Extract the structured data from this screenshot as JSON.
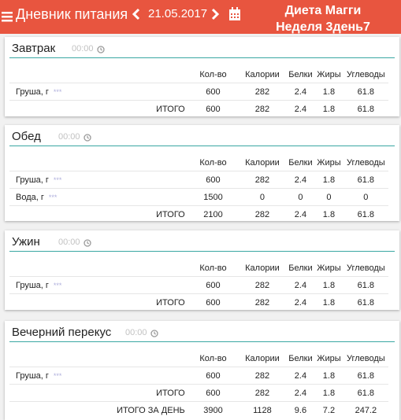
{
  "header": {
    "title": "Дневник питания",
    "date": "21.05.2017",
    "diet_line1": "Диета Магги",
    "diet_line2": "Неделя 3день7",
    "accent_color": "#e8553f",
    "icons": [
      "menu-icon",
      "chevron-left-icon",
      "chevron-right-icon",
      "calendar-icon",
      "clock-icon"
    ]
  },
  "columns": [
    "Кол-во",
    "Калории",
    "Белки",
    "Жиры",
    "Углеводы"
  ],
  "more_glyph": "***",
  "total_label": "ИТОГО",
  "day_total_label": "ИТОГО ЗА ДЕНЬ",
  "meals": [
    {
      "name": "Завтрак",
      "time": "00:00",
      "items": [
        {
          "name": "Груша, г",
          "qty": "600",
          "kcal": "282",
          "protein": "2.4",
          "fat": "1.8",
          "carbs": "61.8"
        }
      ],
      "total": {
        "qty": "600",
        "kcal": "282",
        "protein": "2.4",
        "fat": "1.8",
        "carbs": "61.8"
      }
    },
    {
      "name": "Обед",
      "time": "00:00",
      "items": [
        {
          "name": "Груша, г",
          "qty": "600",
          "kcal": "282",
          "protein": "2.4",
          "fat": "1.8",
          "carbs": "61.8"
        },
        {
          "name": "Вода, г",
          "qty": "1500",
          "kcal": "0",
          "protein": "0",
          "fat": "0",
          "carbs": "0"
        }
      ],
      "total": {
        "qty": "2100",
        "kcal": "282",
        "protein": "2.4",
        "fat": "1.8",
        "carbs": "61.8"
      }
    },
    {
      "name": "Ужин",
      "time": "00:00",
      "items": [
        {
          "name": "Груша, г",
          "qty": "600",
          "kcal": "282",
          "protein": "2.4",
          "fat": "1.8",
          "carbs": "61.8"
        }
      ],
      "total": {
        "qty": "600",
        "kcal": "282",
        "protein": "2.4",
        "fat": "1.8",
        "carbs": "61.8"
      }
    },
    {
      "name": "Вечерний перекус",
      "time": "00:00",
      "items": [
        {
          "name": "Груша, г",
          "qty": "600",
          "kcal": "282",
          "protein": "2.4",
          "fat": "1.8",
          "carbs": "61.8"
        }
      ],
      "total": {
        "qty": "600",
        "kcal": "282",
        "protein": "2.4",
        "fat": "1.8",
        "carbs": "61.8"
      }
    }
  ],
  "day_total": {
    "qty": "3900",
    "kcal": "1128",
    "protein": "9.6",
    "fat": "7.2",
    "carbs": "247.2"
  }
}
